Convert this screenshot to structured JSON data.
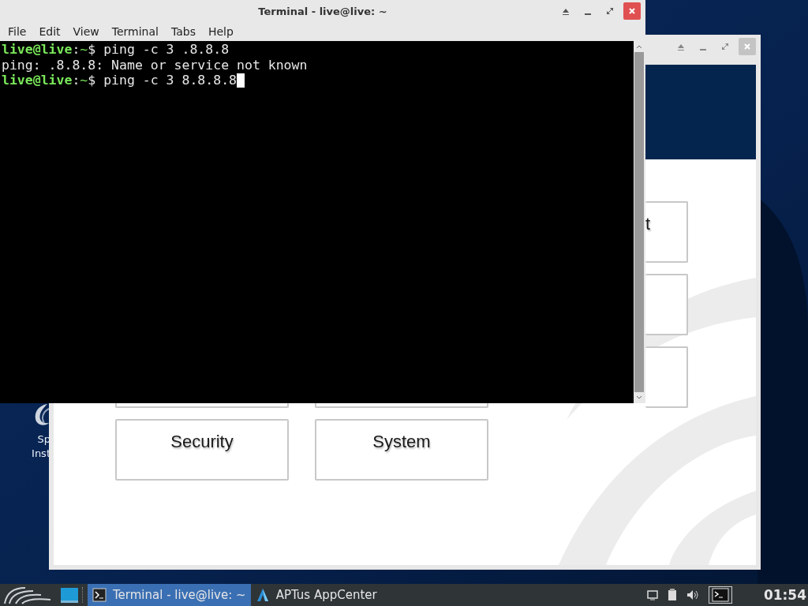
{
  "desktop_icon": {
    "label_lines": [
      "Sp",
      "Inst"
    ]
  },
  "appcenter_window": {
    "grid": [
      {
        "kind": "right_edge",
        "label": "t"
      },
      {
        "kind": "right_edge"
      },
      {
        "kind": "bottom_edge"
      },
      {
        "kind": "bottom_edge"
      },
      {
        "kind": "right_edge"
      },
      {
        "kind": "full",
        "label": "Security"
      },
      {
        "kind": "full",
        "label": "System"
      }
    ]
  },
  "terminal_window": {
    "title": "Terminal - live@live: ~",
    "menu": [
      "File",
      "Edit",
      "View",
      "Terminal",
      "Tabs",
      "Help"
    ],
    "lines": [
      {
        "kind": "prompt",
        "user": "live@live",
        "separator": ":",
        "path": "~",
        "command": "$ ping -c 3 .8.8.8"
      },
      {
        "kind": "output",
        "text": "ping: .8.8.8: Name or service not known"
      },
      {
        "kind": "prompt",
        "user": "live@live",
        "separator": ":",
        "path": "~",
        "command": "$ ping -c 3 8.8.8.8",
        "cursor": true
      }
    ]
  },
  "taskbar": {
    "tasks": [
      {
        "label": "Terminal - live@live: ~",
        "selected": true
      },
      {
        "label": "APTus AppCenter",
        "selected": false
      }
    ],
    "clock": "01:54"
  }
}
